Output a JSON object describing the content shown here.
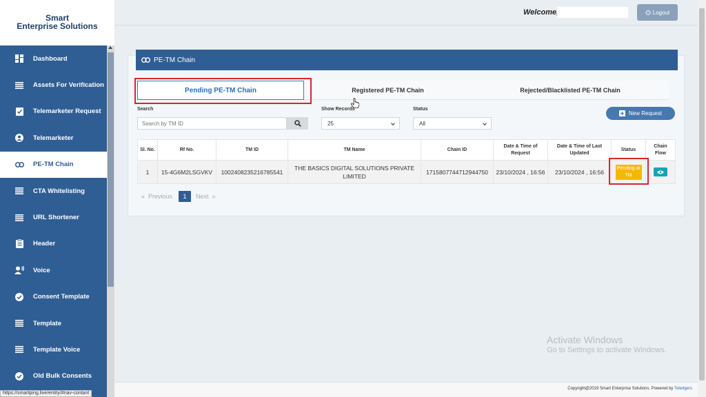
{
  "brand": {
    "line1": "Smart",
    "line2": "Enterprise Solutions"
  },
  "sidebar": {
    "items": [
      {
        "label": "Dashboard",
        "icon": "dashboard-icon",
        "active": false
      },
      {
        "label": "Assets For Verification",
        "icon": "list-icon",
        "active": false
      },
      {
        "label": "Telemarketer Request",
        "icon": "clipboard-check-icon",
        "active": false
      },
      {
        "label": "Telemarketer",
        "icon": "user-circle-icon",
        "active": false
      },
      {
        "label": "PE-TM Chain",
        "icon": "link-icon",
        "active": true
      },
      {
        "label": "CTA Whitelisting",
        "icon": "list-icon",
        "active": false
      },
      {
        "label": "URL Shortener",
        "icon": "list-icon",
        "active": false
      },
      {
        "label": "Header",
        "icon": "clipboard-icon",
        "active": false
      },
      {
        "label": "Voice",
        "icon": "voice-user-icon",
        "active": false
      },
      {
        "label": "Consent Template",
        "icon": "check-circle-icon",
        "active": false
      },
      {
        "label": "Template",
        "icon": "list-icon",
        "active": false
      },
      {
        "label": "Template Voice",
        "icon": "list-icon",
        "active": false
      },
      {
        "label": "Old Bulk Consents",
        "icon": "check-circle-icon",
        "active": false
      }
    ]
  },
  "topbar": {
    "welcome": "Welcome,",
    "logout": "Logout"
  },
  "page": {
    "title": "PE-TM Chain"
  },
  "tabs": [
    {
      "label": "Pending PE-TM Chain",
      "active": true
    },
    {
      "label": "Registered PE-TM Chain",
      "active": false
    },
    {
      "label": "Rejected/Blacklisted PE-TM Chain",
      "active": false
    }
  ],
  "filters": {
    "search_label": "Search",
    "search_placeholder": "Search by TM ID",
    "show_records_label": "Show Records",
    "show_records_value": "25",
    "status_label": "Status",
    "status_value": "All",
    "new_request": "New Request"
  },
  "table": {
    "headers": [
      "Sl. No.",
      "Rf No.",
      "TM ID",
      "TM Name",
      "Chain ID",
      "Date & Time of Request",
      "Date & Time of Last Updated",
      "Status",
      "Chain Flow"
    ],
    "rows": [
      {
        "sl": "1",
        "rf": "15-4G6M2LSGVKV",
        "tm_id": "1002408235216785541",
        "tm_name": "THE BASICS DIGITAL SOLUTIONS PRIVATE LIMITED",
        "chain_id": "1715807744712944750",
        "requested": "23/10/2024 , 16:56",
        "updated": "23/10/2024 , 16:56",
        "status": "Pending at TM"
      }
    ]
  },
  "pagination": {
    "previous": "Previous",
    "current": "1",
    "next": "Next"
  },
  "footer": {
    "text": "Copyright@2019 Smart Enterprise Solutions. Powered by ",
    "link": "Teledgers"
  },
  "watermark": {
    "line1": "Activate Windows",
    "line2": "Go to Settings to activate Windows."
  },
  "status_url": "https://smartping.live/entity/#nav-contant",
  "colors": {
    "primary": "#2f5e94",
    "status_pending": "#f5b800",
    "highlight": "#d9232d",
    "eye_button": "#17a2b8"
  }
}
